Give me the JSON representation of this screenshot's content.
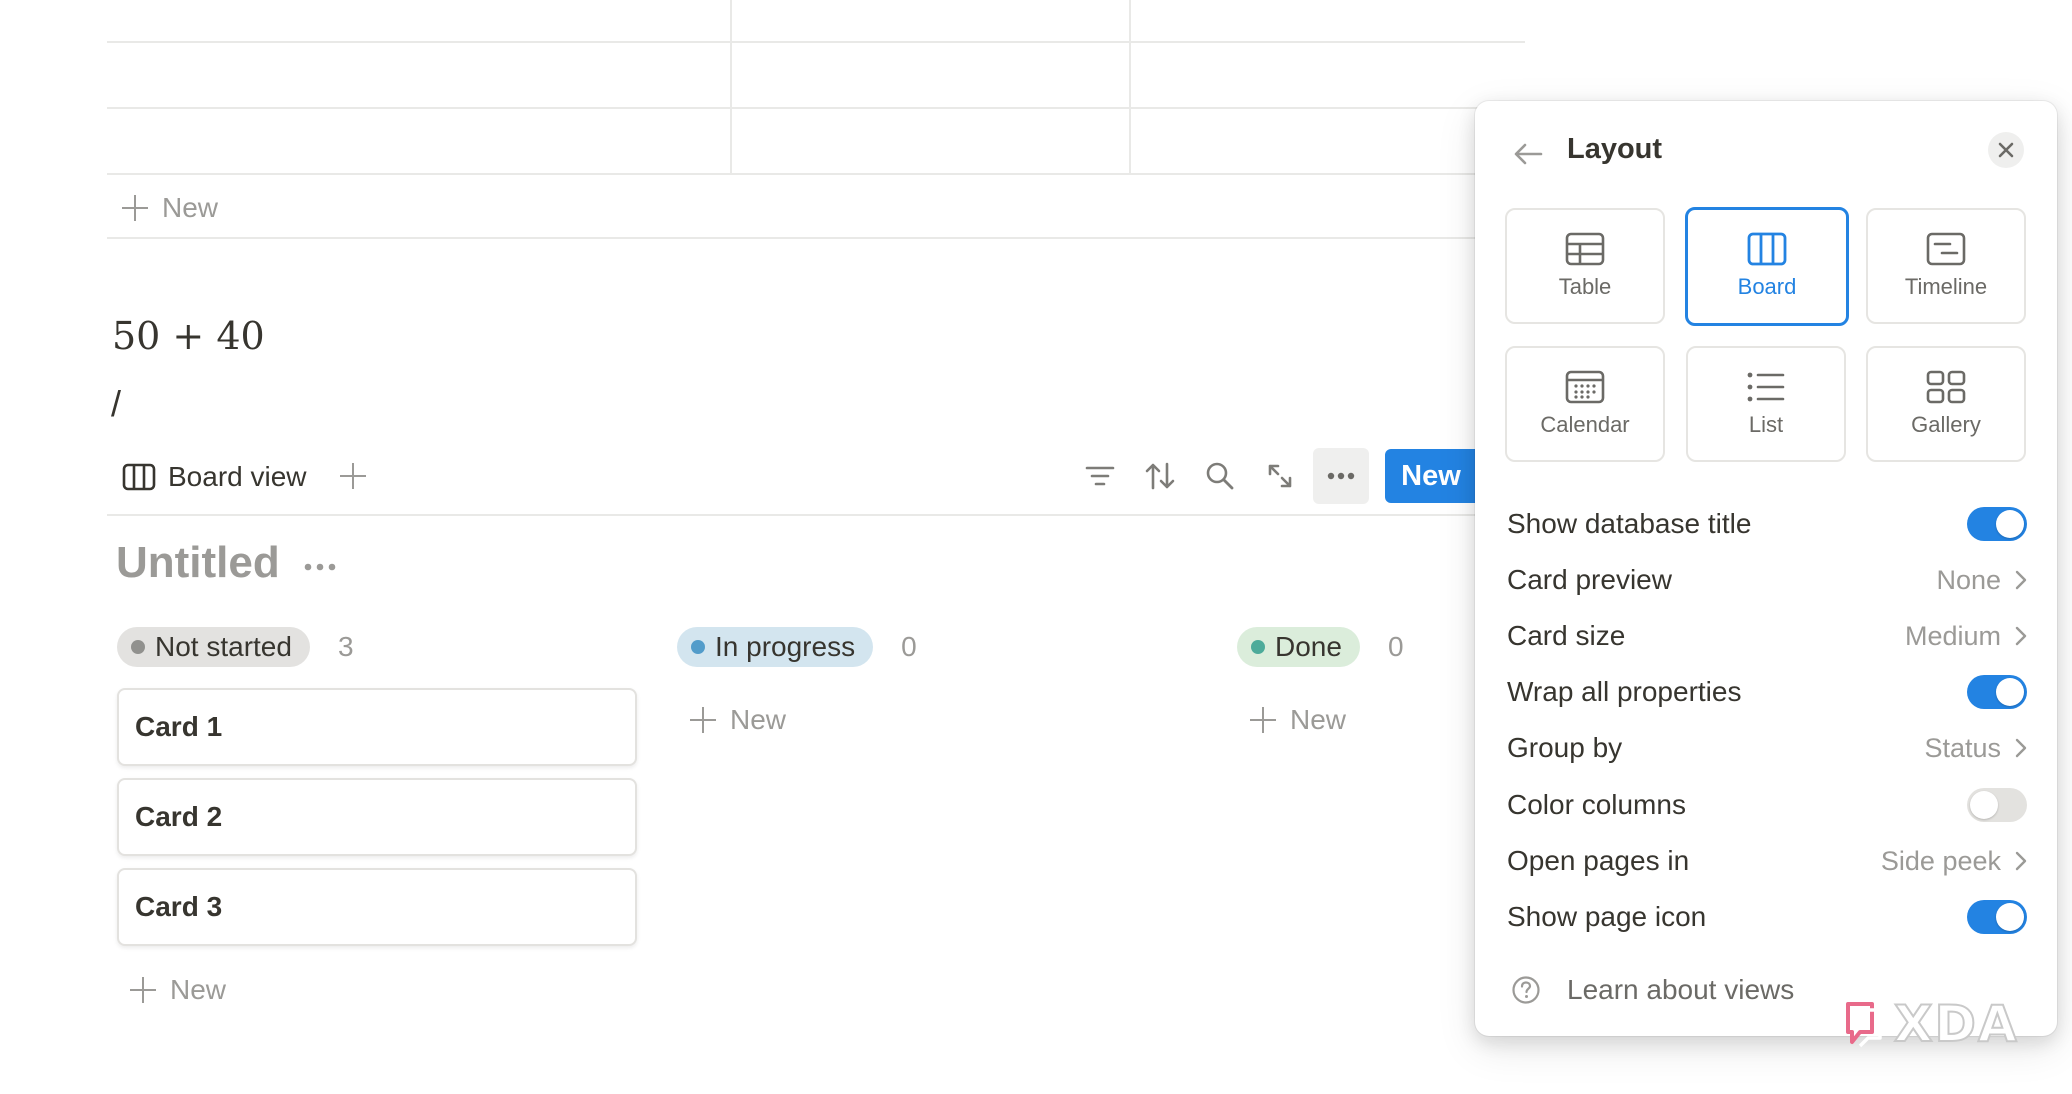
{
  "top_table": {
    "new_label": "New"
  },
  "equation": "50 + 40",
  "slash": "/",
  "viewbar": {
    "view_label": "Board view",
    "new_button": "New"
  },
  "database": {
    "title": "Untitled"
  },
  "board": {
    "groups": [
      {
        "label": "Not started",
        "count": "3",
        "dot": "#91918e",
        "bg": "#e3e2e0"
      },
      {
        "label": "In progress",
        "count": "0",
        "dot": "#529cca",
        "bg": "#d3e5ef"
      },
      {
        "label": "Done",
        "count": "0",
        "dot": "#4dab9a",
        "bg": "#dbeddb"
      }
    ],
    "cards": [
      "Card 1",
      "Card 2",
      "Card 3"
    ],
    "new_label": "New"
  },
  "layout_panel": {
    "title": "Layout",
    "layouts": [
      {
        "label": "Table",
        "icon": "table-icon",
        "active": false
      },
      {
        "label": "Board",
        "icon": "board-icon",
        "active": true
      },
      {
        "label": "Timeline",
        "icon": "timeline-icon",
        "active": false
      },
      {
        "label": "Calendar",
        "icon": "calendar-icon",
        "active": false
      },
      {
        "label": "List",
        "icon": "list-icon",
        "active": false
      },
      {
        "label": "Gallery",
        "icon": "gallery-icon",
        "active": false
      }
    ],
    "settings": [
      {
        "label": "Show database title",
        "type": "toggle",
        "on": true
      },
      {
        "label": "Card preview",
        "type": "select",
        "value": "None"
      },
      {
        "label": "Card size",
        "type": "select",
        "value": "Medium"
      },
      {
        "label": "Wrap all properties",
        "type": "toggle",
        "on": true
      },
      {
        "label": "Group by",
        "type": "select",
        "value": "Status"
      },
      {
        "label": "Color columns",
        "type": "toggle",
        "on": false
      },
      {
        "label": "Open pages in",
        "type": "select",
        "value": "Side peek"
      },
      {
        "label": "Show page icon",
        "type": "toggle",
        "on": true
      }
    ],
    "help_label": "Learn about views"
  },
  "watermark": {
    "text": "XDA"
  },
  "colors": {
    "accent": "#2383e2",
    "muted": "#9b9a97",
    "text": "#37352f"
  }
}
